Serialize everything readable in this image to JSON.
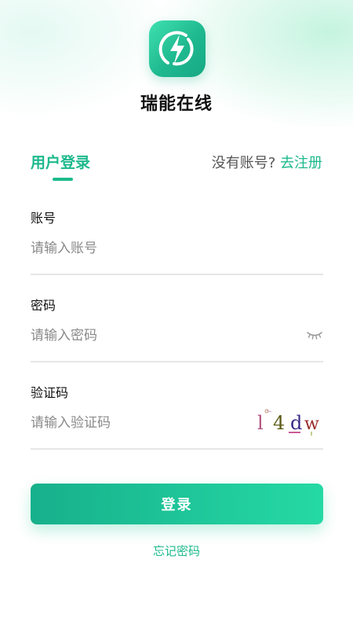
{
  "app": {
    "name": "瑞能在线",
    "logo_icon": "lightning-bolt-icon",
    "accent_color": "#1cb98c"
  },
  "tabs": {
    "login_label": "用户登录"
  },
  "register": {
    "prompt": "没有账号?",
    "link": "去注册"
  },
  "form": {
    "account": {
      "label": "账号",
      "placeholder": "请输入账号",
      "value": ""
    },
    "password": {
      "label": "密码",
      "placeholder": "请输入密码",
      "value": "",
      "toggle_icon": "eye-closed-icon"
    },
    "captcha": {
      "label": "验证码",
      "placeholder": "请输入验证码",
      "value": "",
      "image_text": "l4dw"
    }
  },
  "actions": {
    "login_button": "登录",
    "forgot_password": "忘记密码"
  }
}
